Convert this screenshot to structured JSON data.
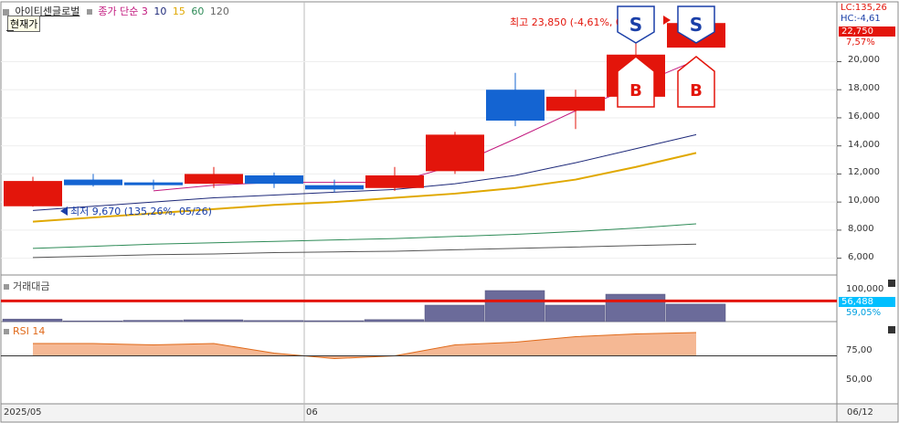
{
  "header": {
    "title": "아이티센글로벌",
    "price_mode": "현재가",
    "ma_label": "종가 단순",
    "ma_periods": [
      "3",
      "10",
      "15",
      "60",
      "120"
    ]
  },
  "right_axis": {
    "lc_label": "LC:135,26",
    "hc_label": "HC:-4,61",
    "current_price_tag": "22,750",
    "change_tag": "7,57%",
    "price_ticks": [
      "20,000",
      "18,000",
      "16,000",
      "14,000",
      "12,000",
      "10,000",
      "8,000",
      "6,000"
    ],
    "volume_ticks": [
      "100,000"
    ],
    "volume_value_tag": "56,488",
    "volume_pct_tag": "59,05%",
    "rsi_ticks": [
      "75,00",
      "50,00"
    ]
  },
  "annotations": {
    "high": "최고 23,850 (-4,61%, 06/13)",
    "low": "최저 9,670 (135,26%, 05/26)"
  },
  "signals": {
    "sell": "S",
    "buy": "B"
  },
  "panels": {
    "volume_title": "거래대금",
    "rsi_title": "RSI 14"
  },
  "x_axis": {
    "left_label": "2025/05",
    "mid_label": "06",
    "right_label": "06/12"
  },
  "chart_data": {
    "type": "candlestick",
    "candles": [
      {
        "open": 11500,
        "high": 11800,
        "low": 9670,
        "close": 9700,
        "color": "red"
      },
      {
        "open": 11600,
        "high": 12000,
        "low": 11100,
        "close": 11200,
        "color": "blue"
      },
      {
        "open": 11400,
        "high": 11600,
        "low": 10900,
        "close": 11200,
        "color": "blue"
      },
      {
        "open": 11300,
        "high": 12500,
        "low": 11000,
        "close": 12000,
        "color": "red"
      },
      {
        "open": 11900,
        "high": 12100,
        "low": 11000,
        "close": 11300,
        "color": "blue"
      },
      {
        "open": 11200,
        "high": 11600,
        "low": 10700,
        "close": 10900,
        "color": "blue"
      },
      {
        "open": 11000,
        "high": 12500,
        "low": 10800,
        "close": 11900,
        "color": "red"
      },
      {
        "open": 12200,
        "high": 15000,
        "low": 12000,
        "close": 14800,
        "color": "red"
      },
      {
        "open": 18000,
        "high": 19200,
        "low": 15400,
        "close": 15800,
        "color": "blue"
      },
      {
        "open": 16500,
        "high": 18000,
        "low": 15200,
        "close": 17500,
        "color": "red"
      },
      {
        "open": 17500,
        "high": 22500,
        "low": 16800,
        "close": 20500,
        "color": "red"
      },
      {
        "open": 21000,
        "high": 23850,
        "low": 21000,
        "close": 22750,
        "color": "red"
      }
    ],
    "ma": [
      {
        "period": "3",
        "color": "#c2187e",
        "values": [
          null,
          null,
          10800,
          11200,
          11400,
          11400,
          11400,
          12600,
          14500,
          16500,
          18300,
          20100
        ]
      },
      {
        "period": "10",
        "color": "#1f2a7a",
        "values": [
          9400,
          9700,
          10000,
          10300,
          10500,
          10700,
          10900,
          11300,
          11900,
          12800,
          13800,
          14800
        ]
      },
      {
        "period": "15",
        "color": "#e0a800",
        "values": [
          8600,
          8900,
          9200,
          9500,
          9800,
          10000,
          10300,
          10600,
          11000,
          11600,
          12500,
          13500
        ]
      },
      {
        "period": "60",
        "color": "#2e8b57",
        "values": [
          6700,
          6850,
          7000,
          7100,
          7200,
          7300,
          7400,
          7550,
          7700,
          7900,
          8150,
          8450
        ]
      },
      {
        "period": "120",
        "color": "#555555",
        "values": [
          6050,
          6150,
          6250,
          6300,
          6400,
          6450,
          6500,
          6600,
          6700,
          6800,
          6900,
          7000
        ]
      }
    ],
    "volume": [
      7000,
      2000,
      3500,
      5000,
      3000,
      2500,
      5500,
      45000,
      85000,
      45000,
      75000,
      48000
    ],
    "volume_reference": 56488,
    "rsi": [
      79,
      79,
      78,
      79,
      72,
      68,
      70,
      78,
      80,
      84,
      86,
      87
    ],
    "rsi_reference": 70,
    "price_range": [
      5000,
      24000
    ],
    "volume_range": [
      0,
      120000
    ],
    "rsi_range": [
      35,
      95
    ],
    "sell_signal_index": [
      10,
      11
    ],
    "buy_signal_index": [
      10,
      11
    ]
  }
}
